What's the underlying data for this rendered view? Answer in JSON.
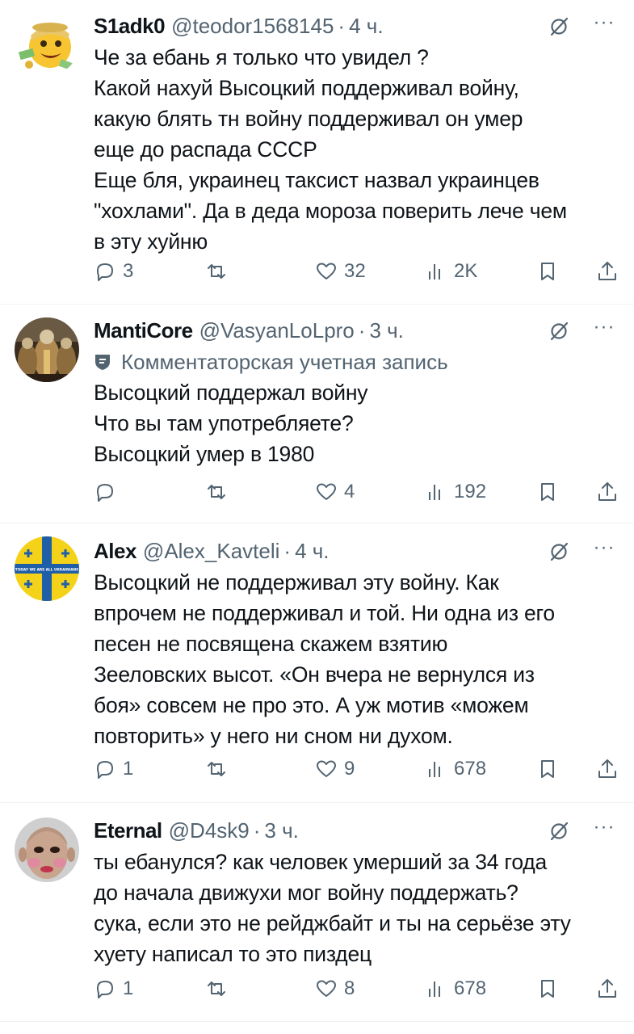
{
  "tweets": [
    {
      "name": "S1adk0",
      "handle": "@teodor1568145",
      "separator": "·",
      "time": "4 ч.",
      "label": "",
      "text": "Че за ебань я только что увидел ?\nКакой нахуй Высоцкий поддерживал войну,\nкакую блять тн войну поддерживал он умер\nеще до распада СССР\nЕще бля, украинец таксист назвал украинцев\n\"хохлами\". Да в деда мороза поверить лече чем\nв эту хуйню",
      "replies": "3",
      "reposts": "",
      "likes": "32",
      "views": "2K",
      "avatar_icon": "smiley-money-emoji-icon"
    },
    {
      "name": "MantiCore",
      "handle": "@VasyanLoLpro",
      "separator": "·",
      "time": "3 ч.",
      "label": "Комментаторская учетная запись",
      "text": "Высоцкий поддержал войну\nЧто вы там употребляете?\nВысоцкий умер в 1980",
      "replies": "",
      "reposts": "",
      "likes": "4",
      "views": "192",
      "avatar_icon": "warrior-figures-image"
    },
    {
      "name": "Alex",
      "handle": "@Alex_Kavteli",
      "separator": "·",
      "time": "4 ч.",
      "label": "",
      "text": "Высоцкий не поддерживал эту войну. Как\nвпрочем не поддерживал и той. Ни одна из его\nпесен не посвящена скажем взятию\nЗееловских высот. «Он вчера не вернулся из\nбоя» совсем не про это. А уж мотив «можем\nповторить» у него ни сном ни духом.",
      "replies": "1",
      "reposts": "",
      "likes": "9",
      "views": "678",
      "avatar_icon": "yellow-blue-cross-flag-image"
    },
    {
      "name": "Eternal",
      "handle": "@D4sk9",
      "separator": "·",
      "time": "3 ч.",
      "label": "",
      "text": "ты ебанулся? как человек умерший за 34 года\nдо начала движухи мог войну поддержать?\nсука, если это не рейджбайт и ты на серьёзе эту\nхуету написал то это пиздец",
      "replies": "1",
      "reposts": "",
      "likes": "8",
      "views": "678",
      "avatar_icon": "face-with-makeup-photo"
    }
  ],
  "avatar_logo_text": "TODAY WE ARE ALL UKRAINIANS",
  "colors": {
    "text": "#0f1419",
    "secondary": "#536471",
    "divider": "#eff3f4"
  }
}
